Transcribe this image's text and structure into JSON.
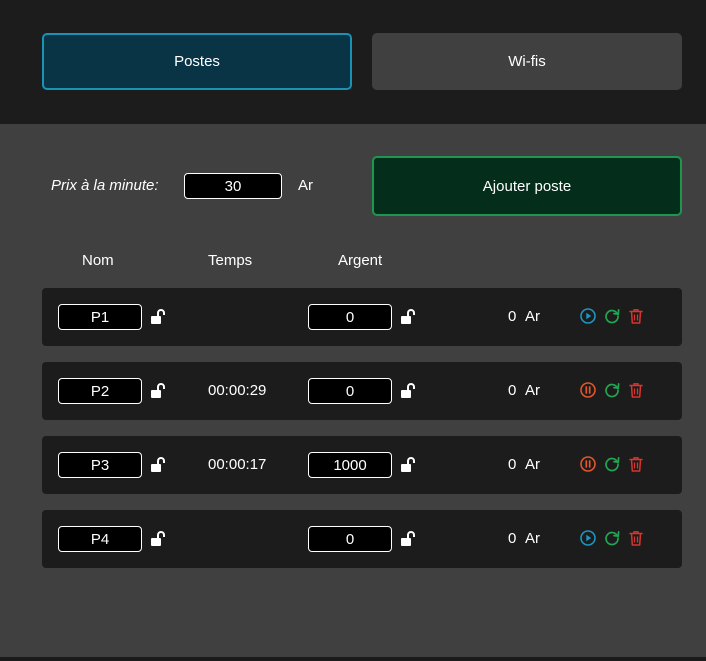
{
  "tabs": {
    "postes": "Postes",
    "wifis": "Wi-fis"
  },
  "pricing": {
    "label": "Prix à la minute:",
    "value": "30",
    "unit": "Ar"
  },
  "add_button": "Ajouter poste",
  "columns": {
    "nom": "Nom",
    "temps": "Temps",
    "argent": "Argent"
  },
  "rows": [
    {
      "name": "P1",
      "time": "",
      "money": "0",
      "amount": "0",
      "unit": "Ar",
      "state": "stopped"
    },
    {
      "name": "P2",
      "time": "00:00:29",
      "money": "0",
      "amount": "0",
      "unit": "Ar",
      "state": "running"
    },
    {
      "name": "P3",
      "time": "00:00:17",
      "money": "1000",
      "amount": "0",
      "unit": "Ar",
      "state": "running"
    },
    {
      "name": "P4",
      "time": "",
      "money": "0",
      "amount": "0",
      "unit": "Ar",
      "state": "stopped"
    }
  ],
  "icons": {
    "lock": "unlocked-lock-icon",
    "play": "play-icon",
    "pause": "pause-icon",
    "reset": "refresh-icon",
    "delete": "trash-icon"
  },
  "colors": {
    "play": "#1e95c1",
    "pause": "#e2562a",
    "reset": "#21a651",
    "delete": "#d8352f",
    "tab_active_bg": "#093446",
    "tab_active_border": "#1892b5",
    "add_bg": "#042d1b",
    "add_border": "#1f9650"
  }
}
